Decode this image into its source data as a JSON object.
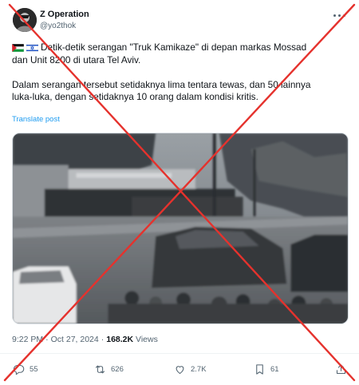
{
  "author": {
    "display_name": "Z Operation",
    "handle": "@yo2thok",
    "avatar_icon": "avatar-icon"
  },
  "post": {
    "flags": [
      "palestine-flag-icon",
      "israel-flag-icon"
    ],
    "paragraph1_line1": "Detik-detik serangan \"Truk Kamikaze\" di depan markas Mossad",
    "paragraph1_line2": "dan Unit 8200 di utara Tel Aviv.",
    "paragraph2_line1": "Dalam serangan tersebut setidaknya lima tentara tewas, dan 50 lainnya",
    "paragraph2_line2": "luka-luka, dengan setidaknya 10 orang dalam kondisi kritis.",
    "translate_label": "Translate post"
  },
  "meta": {
    "time": "9:22 PM",
    "separator": "·",
    "date": "Oct 27, 2024",
    "views_count": "168.2K",
    "views_label": "Views"
  },
  "actions": {
    "replies": "55",
    "reposts": "626",
    "likes": "2.7K",
    "bookmarks": "61"
  },
  "colors": {
    "link": "#1d9bf0",
    "secondary_text": "#536471",
    "overlay_cross": "#e5322d"
  }
}
